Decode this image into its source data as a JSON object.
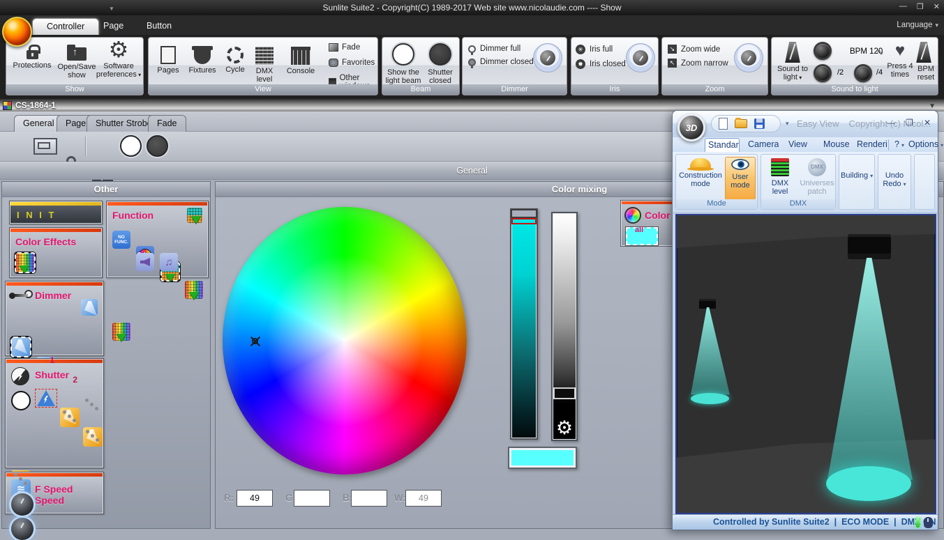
{
  "window": {
    "title": "Sunlite Suite2 - Copyright(C) 1989-2017    Web site www.nicolaudie.com ---- Show",
    "controls": {
      "minimize": "—",
      "maximize": "❐",
      "close": "✕"
    },
    "language": "Language",
    "quick_access_arrow": "▼"
  },
  "tabs": [
    {
      "label": "Controller"
    },
    {
      "label": "Page"
    },
    {
      "label": "Button"
    }
  ],
  "ribbon": {
    "show": {
      "label": "Show",
      "protections": "Protections",
      "open_save": "Open/Save show",
      "software_pref": "Software preferences"
    },
    "view": {
      "label": "View",
      "pages": "Pages",
      "fixtures": "Fixtures",
      "cycle": "Cycle",
      "dmx_level": "DMX level",
      "console": "Console",
      "fade": "Fade",
      "favorites": "Favorites",
      "other_windows": "Other windows"
    },
    "beam": {
      "label": "Beam",
      "show_beam": "Show the light beam",
      "shutter_closed": "Shutter closed"
    },
    "dimmer": {
      "label": "Dimmer",
      "full": "Dimmer full",
      "closed": "Dimmer closed"
    },
    "iris": {
      "label": "Iris",
      "full": "Iris full",
      "closed": "Iris closed"
    },
    "zoom": {
      "label": "Zoom",
      "wide": "Zoom wide",
      "narrow": "Zoom narrow"
    },
    "sound": {
      "label": "Sound to light",
      "sound_to_light": "Sound to light",
      "bpm": "BPM 120",
      "div2": "/2",
      "div4": "/4",
      "press4": "Press 4 times",
      "bpm_reset": "BPM reset"
    }
  },
  "cs_window": {
    "title": "CS-1864-1",
    "collapse_arrow": "▼",
    "tabs": [
      "General",
      "Page",
      "Shutter Strobe",
      "Fade"
    ],
    "section_header": "General"
  },
  "other_panel": {
    "title": "Other",
    "init_label": "I N I T",
    "function_label": "Function",
    "no_func_line1": "NO",
    "no_func_line2": "FUNC.",
    "color_icon_label": "Color",
    "color_effects_label": "Color Effects",
    "dimmer_label": "Dimmer",
    "beam1": "1",
    "beam2": "2",
    "shutter_label": "Shutter",
    "f_speed_label": "F Speed Speed",
    "music_note": "♫"
  },
  "mixing_panel": {
    "title": "Color mixing",
    "color_box_label": "Color",
    "color_box_swatch": "all",
    "gear_glyph": "⚙",
    "rgbw": {
      "r_label": "R:",
      "g_label": "G:",
      "b_label": "B:",
      "w_label": "W:",
      "r": "49",
      "g": "",
      "b": "",
      "w": "49"
    }
  },
  "easy_view": {
    "logo": "3D",
    "title_app": "Easy View",
    "title_copyright": "Copyright (c) Nicol...",
    "controls": {
      "minimize": "—",
      "maximize": "❐",
      "close": "✕"
    },
    "menu": [
      "Standard",
      "Camera",
      "View",
      "Mouse",
      "Rendering"
    ],
    "help": "?",
    "options": "Options",
    "buttons": {
      "construction": "Construction mode",
      "user": "User mode",
      "dmx_level": "DMX level",
      "universes": "Universes patch",
      "building": "Building",
      "undo": "Undo Redo"
    },
    "group_mode": "Mode",
    "group_dmx": "DMX",
    "status": {
      "controlled": "Controlled by Sunlite Suite2",
      "sep": "|",
      "eco": "ECO MODE",
      "dmx_on": "DMX ON"
    }
  },
  "colors": {
    "beam_cyan": "#47E6D8",
    "swatch_cyan": "#55FFFF",
    "label_pink": "#E3156F",
    "init_yellow": "#D6CC26",
    "section_bar_orange": "#E8431C",
    "user_mode_highlight": "#F5AA42"
  }
}
